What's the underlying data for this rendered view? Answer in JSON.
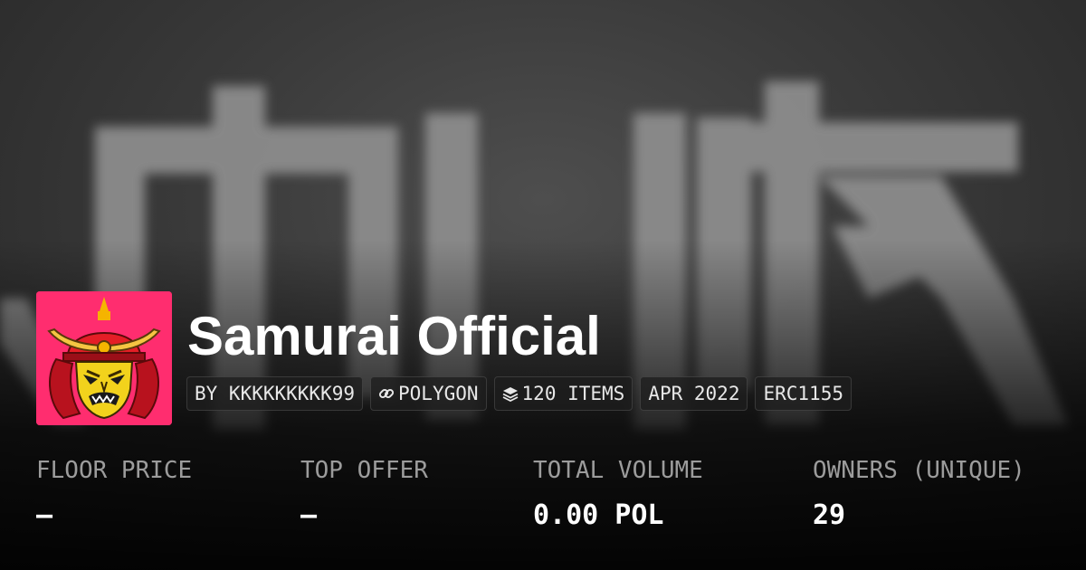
{
  "collection": {
    "name": "Samurai Official",
    "avatar_icon": "samurai-mask-icon",
    "avatar_background": "#ff2d6f"
  },
  "tags": [
    {
      "label": "BY KKKKKKKKK99",
      "icon": null
    },
    {
      "label": "POLYGON",
      "icon": "link-icon"
    },
    {
      "label": "120 ITEMS",
      "icon": "layers-icon"
    },
    {
      "label": "APR 2022",
      "icon": null
    },
    {
      "label": "ERC1155",
      "icon": null
    }
  ],
  "stats": [
    {
      "label": "FLOOR PRICE",
      "value": "–"
    },
    {
      "label": "TOP OFFER",
      "value": "–"
    },
    {
      "label": "TOTAL VOLUME",
      "value": "0.00 POL"
    },
    {
      "label": "OWNERS (UNIQUE)",
      "value": "29"
    }
  ],
  "colors": {
    "title": "#ffffff",
    "stat_label": "#9c9c9c",
    "stat_value": "#ffffff",
    "tag_text": "#e8e8e8"
  }
}
